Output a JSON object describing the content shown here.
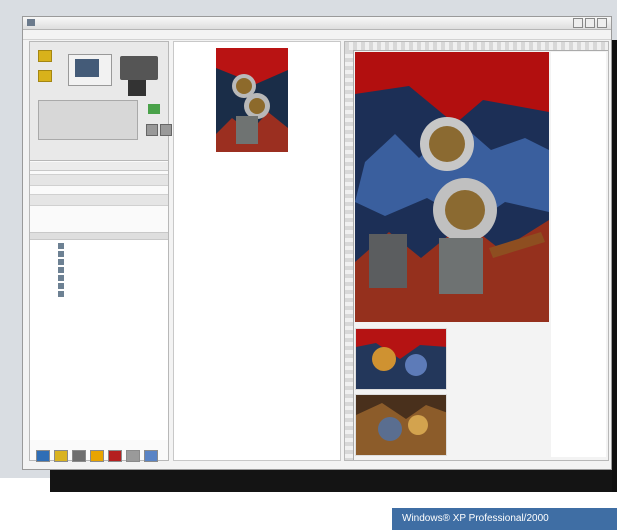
{
  "badge": {
    "text": "Windows® XP Professional/2000"
  },
  "colors": {
    "accent": "#3f6ea4"
  }
}
